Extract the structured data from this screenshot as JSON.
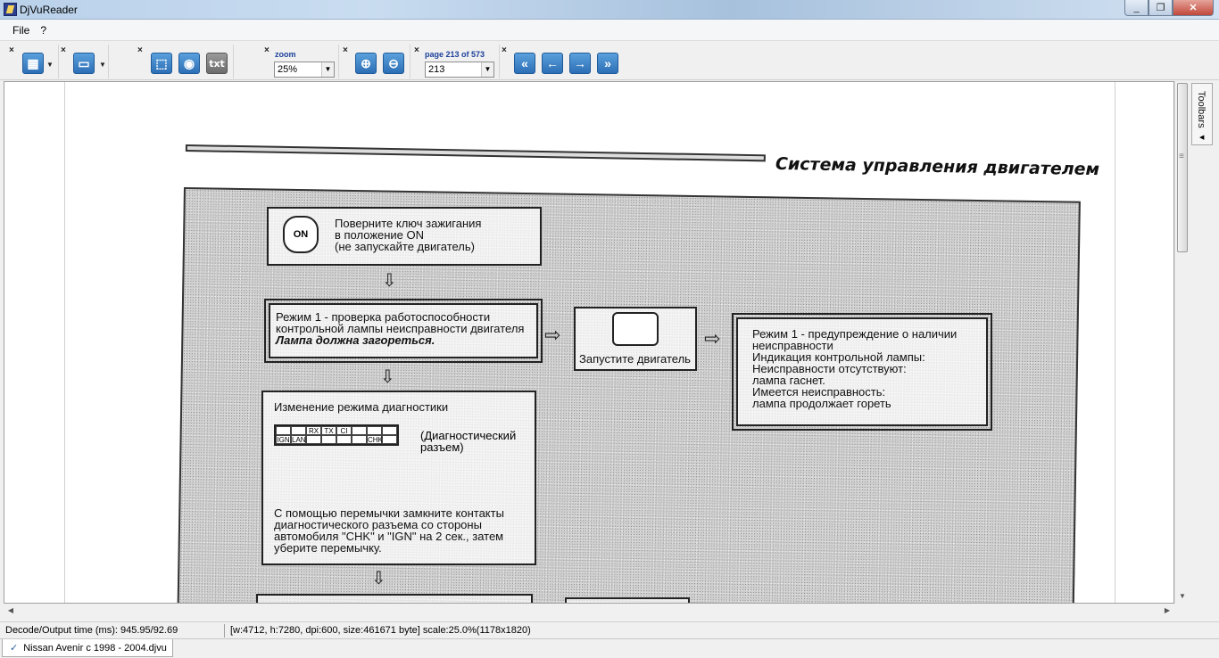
{
  "window": {
    "title": "DjVuReader",
    "minimize": "_",
    "maximize": "❐",
    "close": "✕"
  },
  "menu": {
    "items": [
      "File",
      "?"
    ]
  },
  "toolbar": {
    "close_glyph": "×",
    "text_button": "txt",
    "zoom": {
      "label": "zoom",
      "value": "25%"
    },
    "page": {
      "label": "page 213 of 573",
      "value": "213"
    },
    "nav_icons": [
      "first-page-icon",
      "previous-page-icon",
      "next-page-icon",
      "last-page-icon"
    ]
  },
  "document": {
    "heading": "Система управления двигателем",
    "box1": [
      "Поверните ключ зажигания",
      "в положение ON",
      "(не запускайте двигатель)"
    ],
    "key_label": "ON",
    "box2": [
      "Режим 1 - проверка работоспособности",
      "контрольной лампы неисправности двигателя"
    ],
    "box2_bold": "Лампа должна загореться.",
    "box3": "Запустите двигатель",
    "box4": [
      "Режим 1 - предупреждение о наличии",
      "неисправности",
      "Индикация контрольной лампы:",
      "Неисправности отсутствуют:",
      "лампа гаснет.",
      "Имеется неисправность:",
      "лампа продолжает гореть"
    ],
    "box5_title": "Изменение режима диагностики",
    "connector_caption": [
      "(Диагностический",
      "разъем)"
    ],
    "connector_pins": [
      "",
      "",
      "RX",
      "TX",
      "CI",
      "",
      "",
      "",
      "IGN",
      "LAN",
      "",
      "",
      "",
      "",
      "CHK",
      ""
    ],
    "box5_text": [
      "С помощью перемычки замкните контакты",
      "диагностического разъема со стороны",
      "автомобиля \"CHK\" и \"IGN\" на 2 сек., затем",
      "уберите перемычку."
    ]
  },
  "sidebar": {
    "toolbars_label": "Toolbars"
  },
  "status": {
    "decode_time": "Decode/Output time (ms): 945.95/92.69",
    "image_info": "[w:4712, h:7280, dpi:600, size:461671 byte] scale:25.0%(1178x1820)"
  },
  "tabs": {
    "document": "Nissan Avenir c 1998 - 2004.djvu"
  }
}
